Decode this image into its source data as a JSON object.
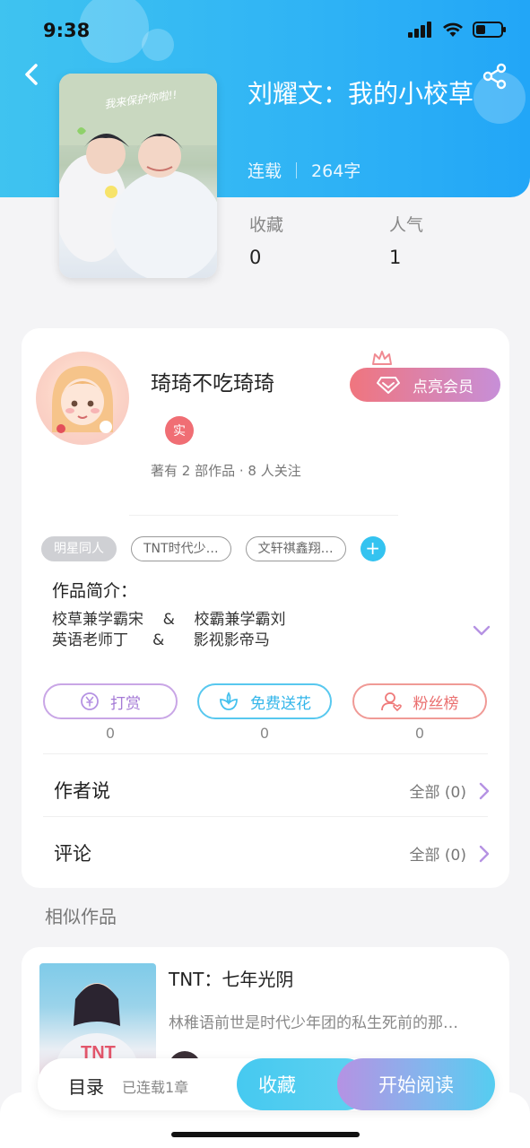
{
  "status_bar": {
    "time": "9:38"
  },
  "book": {
    "title": "刘耀文：我的小校草",
    "status": "连载",
    "word_count": "264字",
    "cover_caption": "我来保护你啦!!",
    "stats": [
      {
        "label": "收藏",
        "value": "0"
      },
      {
        "label": "人气",
        "value": "1"
      }
    ]
  },
  "author": {
    "name": "琦琦不吃琦琦",
    "badge": "实",
    "meta": "著有 2 部作品 · 8 人关注",
    "vip_button": "点亮会员"
  },
  "tags": [
    "明星同人",
    "TNT时代少…",
    "文轩祺鑫翔…"
  ],
  "intro": {
    "label": "作品简介：",
    "line1": "校草兼学霸宋    &    校霸兼学霸刘",
    "line2": "英语老师丁     &      影视影帝马"
  },
  "actions": [
    {
      "label": "打赏",
      "count": "0",
      "icon": "yuan-icon",
      "color": "#b58ad8"
    },
    {
      "label": "免费送花",
      "count": "0",
      "icon": "flower-icon",
      "color": "#45c1ee"
    },
    {
      "label": "粉丝榜",
      "count": "0",
      "icon": "fan-rank-icon",
      "color": "#ef7a7a"
    }
  ],
  "rows": [
    {
      "label": "作者说",
      "right": "全部 (0)"
    },
    {
      "label": "评论",
      "right": "全部 (0)"
    }
  ],
  "similar": {
    "section_title": "相似作品",
    "items": [
      {
        "title": "TNT：七年光阴",
        "desc": "林稚语前世是时代少年团的私生死前的那…",
        "cover_text": "TNT"
      }
    ]
  },
  "bottom_bar": {
    "toc": "目录",
    "toc_status": "已连载1章",
    "favorite": "收藏",
    "start_reading": "开始阅读"
  },
  "colors": {
    "header": "#2fb3f5",
    "accent_blue": "#45c1ee",
    "accent_purple": "#b58ad8",
    "accent_red": "#ef7a7a"
  }
}
